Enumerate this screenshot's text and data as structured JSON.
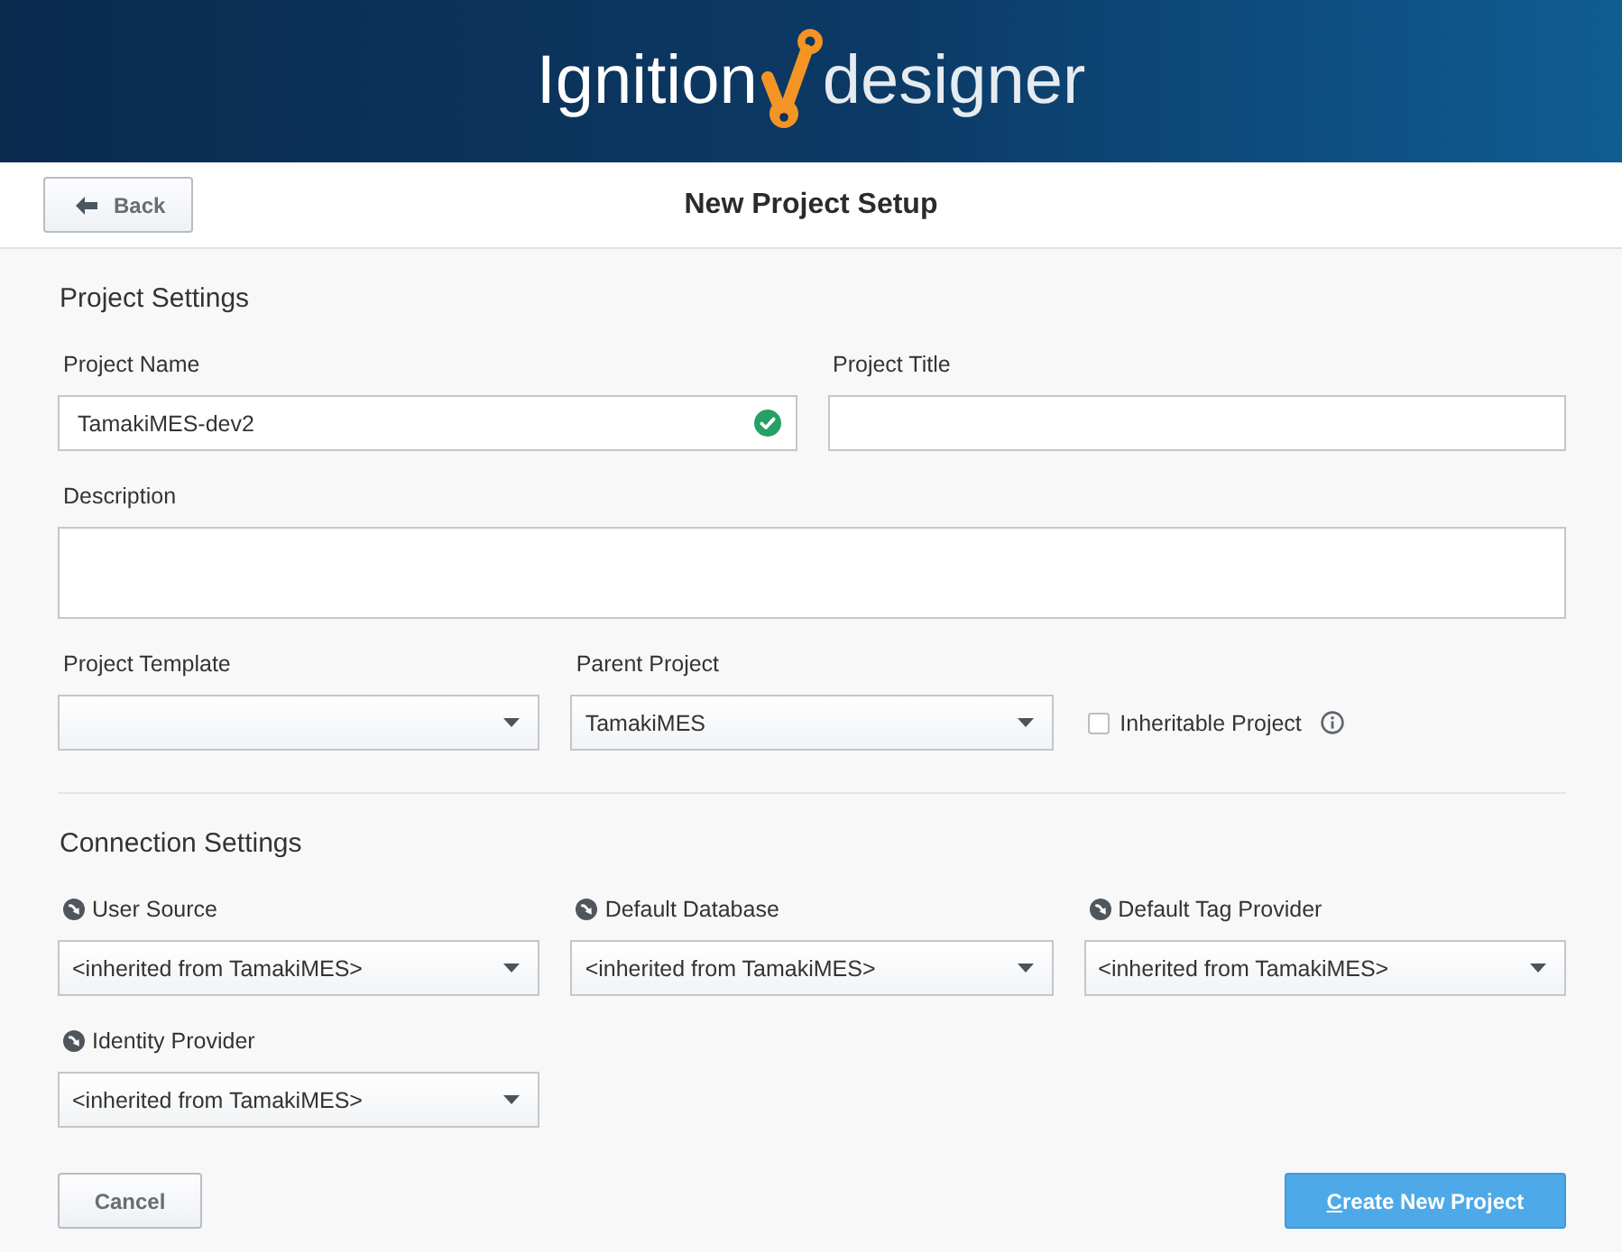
{
  "header": {
    "logo_left": "Ignition",
    "logo_right": "designer"
  },
  "toolbar": {
    "back_label": "Back",
    "title": "New Project Setup"
  },
  "project_settings": {
    "heading": "Project Settings",
    "rows": [
      {
        "fields": [
          {
            "kind": "text",
            "label": "Project Name",
            "value": "TamakiMES-dev2",
            "valid": true
          },
          {
            "kind": "text",
            "label": "Project Title",
            "valid": false
          }
        ]
      },
      {
        "fields": [
          {
            "kind": "textarea",
            "label": "Description"
          }
        ]
      },
      {
        "fields": [
          {
            "kind": "select",
            "label": "Project Template"
          },
          {
            "kind": "select",
            "label": "Parent Project",
            "value": "TamakiMES"
          },
          {
            "kind": "checkbox",
            "label": "Inheritable Project",
            "checked": false
          }
        ]
      }
    ]
  },
  "connection_settings": {
    "heading": "Connection Settings",
    "fields": [
      {
        "label": "User Source",
        "value": "<inherited from TamakiMES>",
        "inherited": true
      },
      {
        "label": "Default Database",
        "value": "<inherited from TamakiMES>",
        "inherited": true
      },
      {
        "label": "Default Tag Provider",
        "value": "<inherited from TamakiMES>",
        "inherited": true
      },
      {
        "label": "Identity Provider",
        "value": "<inherited from TamakiMES>",
        "inherited": true
      }
    ]
  },
  "footer": {
    "buttons": [
      {
        "kind": "secondary",
        "label": "Cancel",
        "mnemonic": false
      },
      {
        "kind": "primary",
        "label": "Create New Project",
        "mnemonic": true
      }
    ]
  }
}
